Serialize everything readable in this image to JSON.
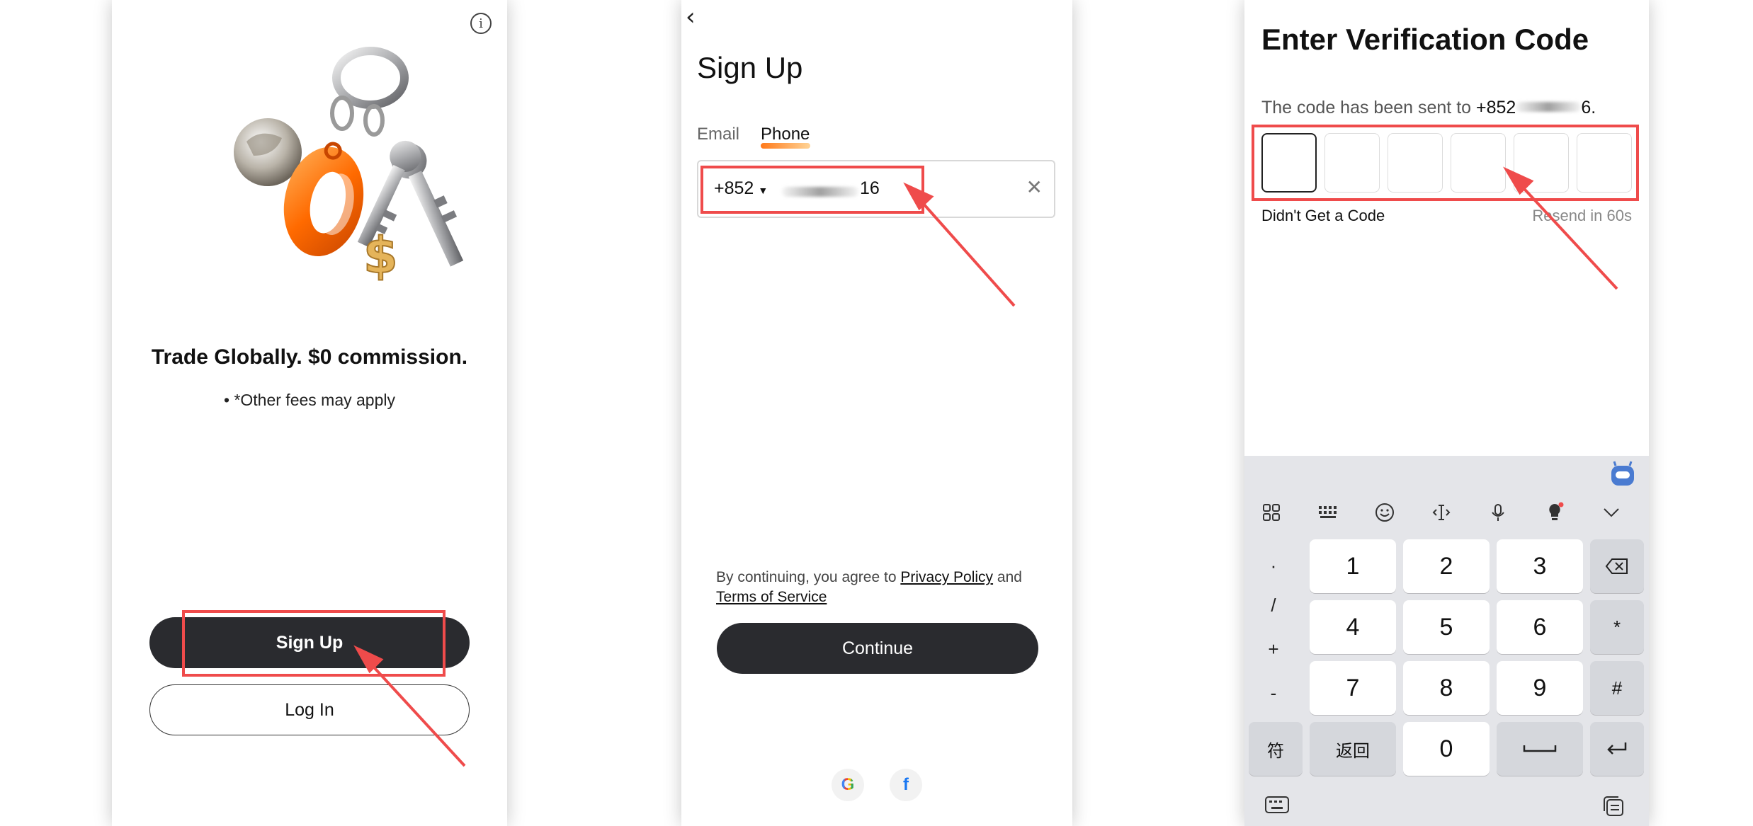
{
  "screen1": {
    "headline": "Trade Globally. $0 commission.",
    "note": "• *Other fees may apply",
    "signup_label": "Sign Up",
    "login_label": "Log In",
    "hero_key_tag_text": "0",
    "hero_dollar_text": "$"
  },
  "screen2": {
    "title": "Sign Up",
    "tabs": [
      "Email",
      "Phone"
    ],
    "active_tab": "Phone",
    "country_code": "+852",
    "phone_suffix": "16",
    "consent_prefix": "By continuing, you agree to",
    "privacy_link": "Privacy Policy",
    "consent_and": "and",
    "terms_link": "Terms of Service",
    "continue_label": "Continue",
    "social": [
      "G",
      "f"
    ]
  },
  "screen3": {
    "title": "Enter Verification Code",
    "sent_prefix": "The code has been sent to",
    "sent_number_start": "+852",
    "sent_number_end": "6.",
    "didnt_get": "Didn't Get a Code",
    "resend": "Resend in 60s",
    "code_slots": 6,
    "keyboard": {
      "symbols": [
        "·",
        "/",
        "+",
        "-"
      ],
      "rows": [
        [
          "1",
          "2",
          "3"
        ],
        [
          "4",
          "5",
          "6"
        ],
        [
          "7",
          "8",
          "9"
        ]
      ],
      "right_col": [
        "*",
        "#"
      ],
      "bottom_left": "符",
      "back_label": "返回",
      "zero": "0"
    }
  },
  "colors": {
    "highlight": "#ef4b4b",
    "dark_button": "#2a2b2f",
    "keyboard_bg": "#e4e5e9",
    "accent_orange": "#ff6a00"
  },
  "icons": [
    "info-icon",
    "back-chevron-icon",
    "clear-icon",
    "google-icon",
    "facebook-icon",
    "menu-grid-icon",
    "keyboard-icon",
    "emoji-icon",
    "cursor-icon",
    "mic-icon",
    "lightbulb-icon",
    "collapse-icon",
    "backspace-icon",
    "space-icon",
    "enter-icon",
    "clipboard-icon"
  ]
}
